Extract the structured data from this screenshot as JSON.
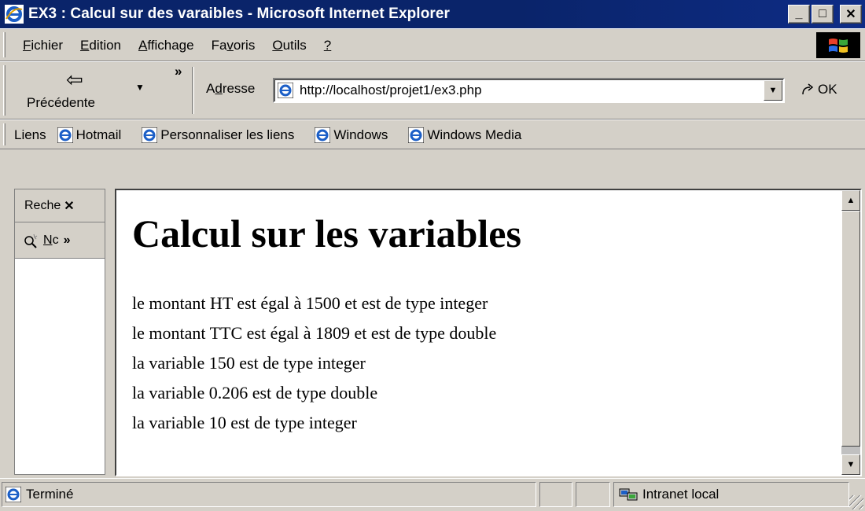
{
  "window": {
    "title": "EX3 : Calcul sur des varaibles - Microsoft Internet Explorer",
    "controls": {
      "minimize": "_",
      "maximize": "□",
      "close": "✕"
    }
  },
  "menubar": {
    "items": [
      {
        "label": "Fichier",
        "accel": "F",
        "rest": "ichier"
      },
      {
        "label": "Edition",
        "accel": "E",
        "rest": "dition"
      },
      {
        "label": "Affichage",
        "accel": "A",
        "rest": "ffichage"
      },
      {
        "label": "Favoris",
        "pre": "Fa",
        "accel": "v",
        "rest": "oris"
      },
      {
        "label": "Outils",
        "accel": "O",
        "rest": "utils"
      },
      {
        "label": "?",
        "accel": "?",
        "rest": ""
      }
    ]
  },
  "toolbar": {
    "back_label": "Précédente",
    "back_arrow": "⇦",
    "dropdown_arrow": "▼",
    "more": "»",
    "address_label_pre": "A",
    "address_label_accel": "d",
    "address_label_rest": "resse",
    "address_url": "http://localhost/projet1/ex3.php",
    "go_label": "OK",
    "go_icon": "go-arrow-icon"
  },
  "links": {
    "label": "Liens",
    "items": [
      "Hotmail",
      "Personnaliser les liens",
      "Windows",
      "Windows Media"
    ]
  },
  "explorer_bar": {
    "title": "Reche",
    "close": "✕",
    "more": "»",
    "new_pre": "",
    "new_accel": "N",
    "new_rest": "c"
  },
  "page": {
    "heading": "Calcul sur les variables",
    "lines": [
      "le montant HT est égal à 1500 et est de type integer",
      "le montant TTC est égal à 1809 et est de type double",
      "la variable 150 est de type integer",
      "la variable 0.206 est de type double",
      "la variable 10 est de type integer"
    ]
  },
  "statusbar": {
    "status_text": "Terminé",
    "zone_text": "Intranet local"
  },
  "colors": {
    "titlebar": "#0a246a",
    "chrome": "#d4d0c8",
    "ie_blue": "#1c5fc7"
  }
}
